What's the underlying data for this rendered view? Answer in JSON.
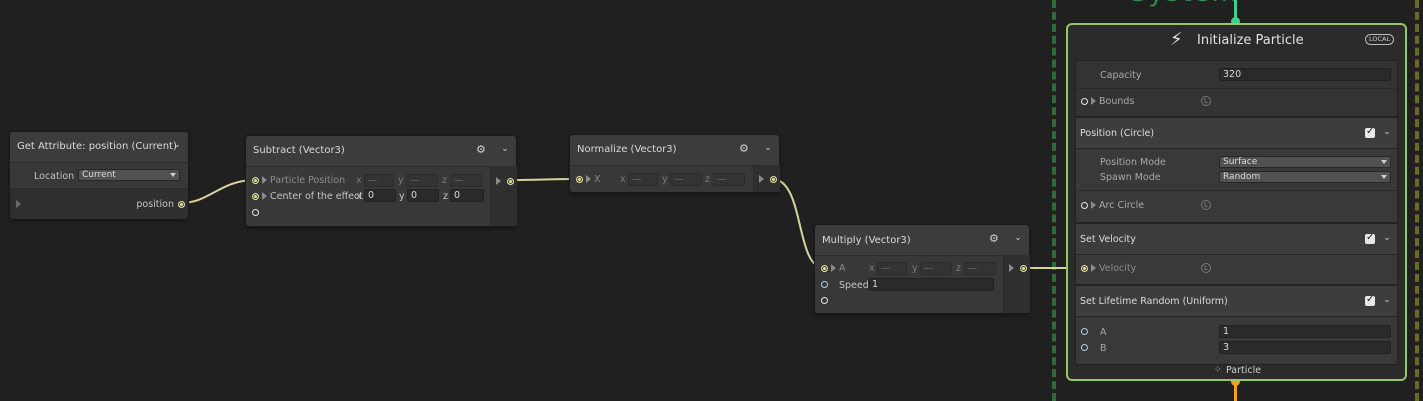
{
  "context_title_partial": "System",
  "nodes": {
    "get_attribute": {
      "title": "Get Attribute: position (Current)",
      "location_label": "Location",
      "location_value": "Current",
      "output_label": "position"
    },
    "subtract": {
      "title": "Subtract (Vector3)",
      "input1_label": "Particle Position",
      "input1_x": "—",
      "input1_y": "—",
      "input1_z": "—",
      "input2_label": "Center of the effect",
      "input2_x": "0",
      "input2_y": "0",
      "input2_z": "0",
      "axis_x": "x",
      "axis_y": "y",
      "axis_z": "z"
    },
    "normalize": {
      "title": "Normalize (Vector3)",
      "input_label": "X",
      "x": "—",
      "y": "—",
      "z": "—",
      "axis_x": "x",
      "axis_y": "y",
      "axis_z": "z"
    },
    "multiply": {
      "title": "Multiply (Vector3)",
      "input_a_label": "A",
      "a_x": "—",
      "a_y": "—",
      "a_z": "—",
      "speed_label": "Speed",
      "speed_value": "1",
      "axis_x": "x",
      "axis_y": "y",
      "axis_z": "z"
    }
  },
  "initialize": {
    "title": "Initialize Particle",
    "space_badge": "LOCAL",
    "capacity_label": "Capacity",
    "capacity_value": "320",
    "bounds_label": "Bounds",
    "footer_label": "Particle",
    "blocks": {
      "position": {
        "title": "Position (Circle)",
        "mode_label": "Position Mode",
        "mode_value": "Surface",
        "spawn_label": "Spawn Mode",
        "spawn_value": "Random",
        "arc_label": "Arc Circle"
      },
      "velocity": {
        "title": "Set Velocity",
        "velocity_label": "Velocity"
      },
      "lifetime": {
        "title": "Set Lifetime Random (Uniform)",
        "a_label": "A",
        "a_value": "1",
        "b_label": "B",
        "b_value": "3"
      }
    },
    "local_badge_letter": "L"
  },
  "colors": {
    "background": "#202020",
    "node": "#383838",
    "wire_vector": "#d6d49a",
    "flow_in": "#3fd08a",
    "flow_out": "#f0a126",
    "context_border": "#96c76a"
  }
}
